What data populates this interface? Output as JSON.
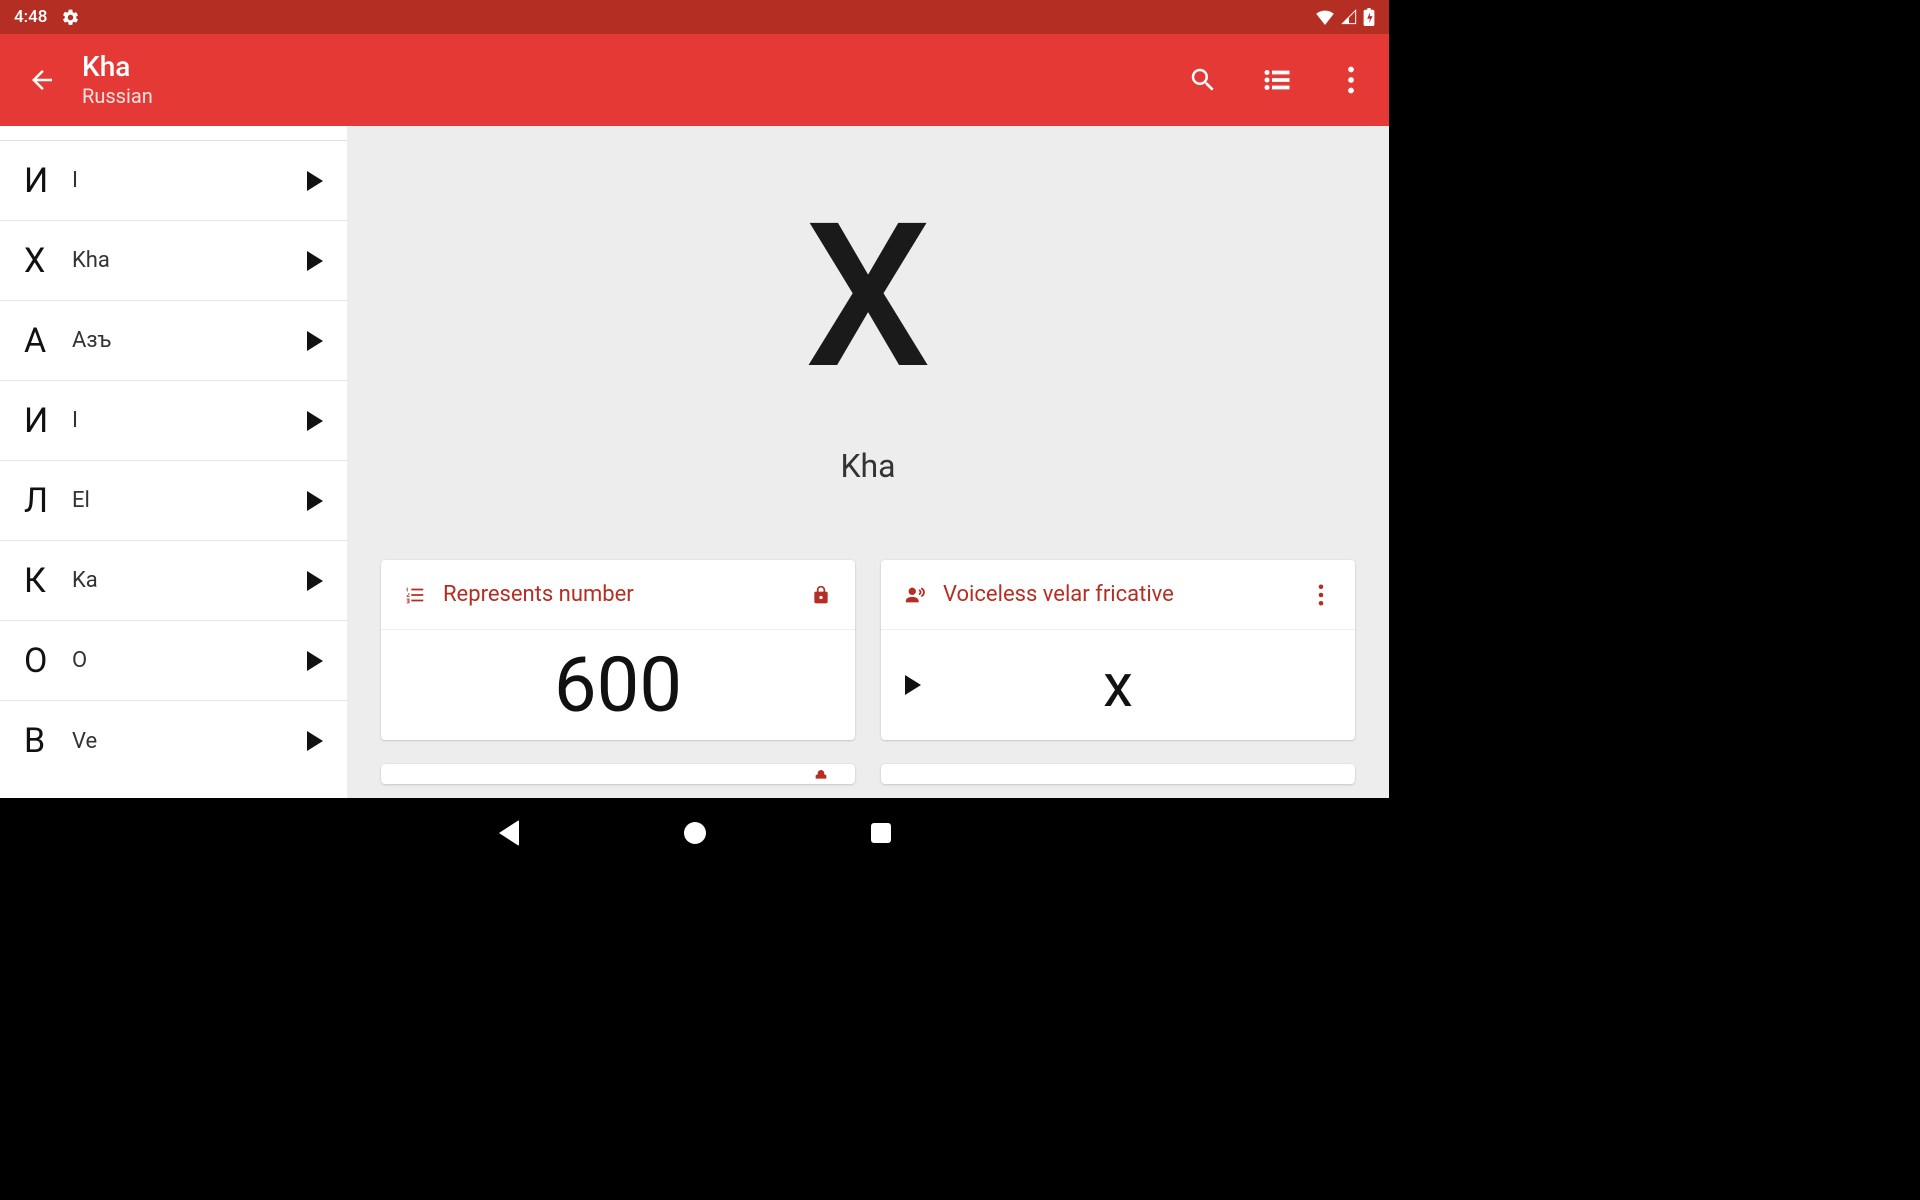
{
  "colors": {
    "status_bg": "#b52e24",
    "appbar_bg": "#e53935",
    "accent": "#b52e24"
  },
  "status_bar": {
    "time": "4:48",
    "left_icon": "settings-gear",
    "right_icons": [
      "wifi",
      "signal",
      "battery-charging"
    ]
  },
  "app_bar": {
    "title": "Kha",
    "subtitle": "Russian",
    "actions": {
      "search": "search-icon",
      "list": "list-icon",
      "overflow": "more-vert-icon"
    }
  },
  "sidebar": {
    "items": [
      {
        "glyph": "И",
        "label": "I"
      },
      {
        "glyph": "Х",
        "label": "Kha"
      },
      {
        "glyph": "А",
        "label": "Азъ"
      },
      {
        "glyph": "И",
        "label": "I"
      },
      {
        "glyph": "Л",
        "label": "El"
      },
      {
        "glyph": "К",
        "label": "Ka"
      },
      {
        "glyph": "О",
        "label": "O"
      },
      {
        "glyph": "В",
        "label": "Ve"
      }
    ]
  },
  "hero": {
    "glyph": "Х",
    "label": "Kha"
  },
  "cards": {
    "number": {
      "icon_label": "list-number-icon",
      "title": "Represents number",
      "right_icon_label": "lock-icon",
      "value": "600"
    },
    "sound": {
      "icon_label": "voice-icon",
      "title": "Voiceless velar fricative",
      "right_icon_label": "more-vert-icon",
      "value": "x"
    }
  }
}
